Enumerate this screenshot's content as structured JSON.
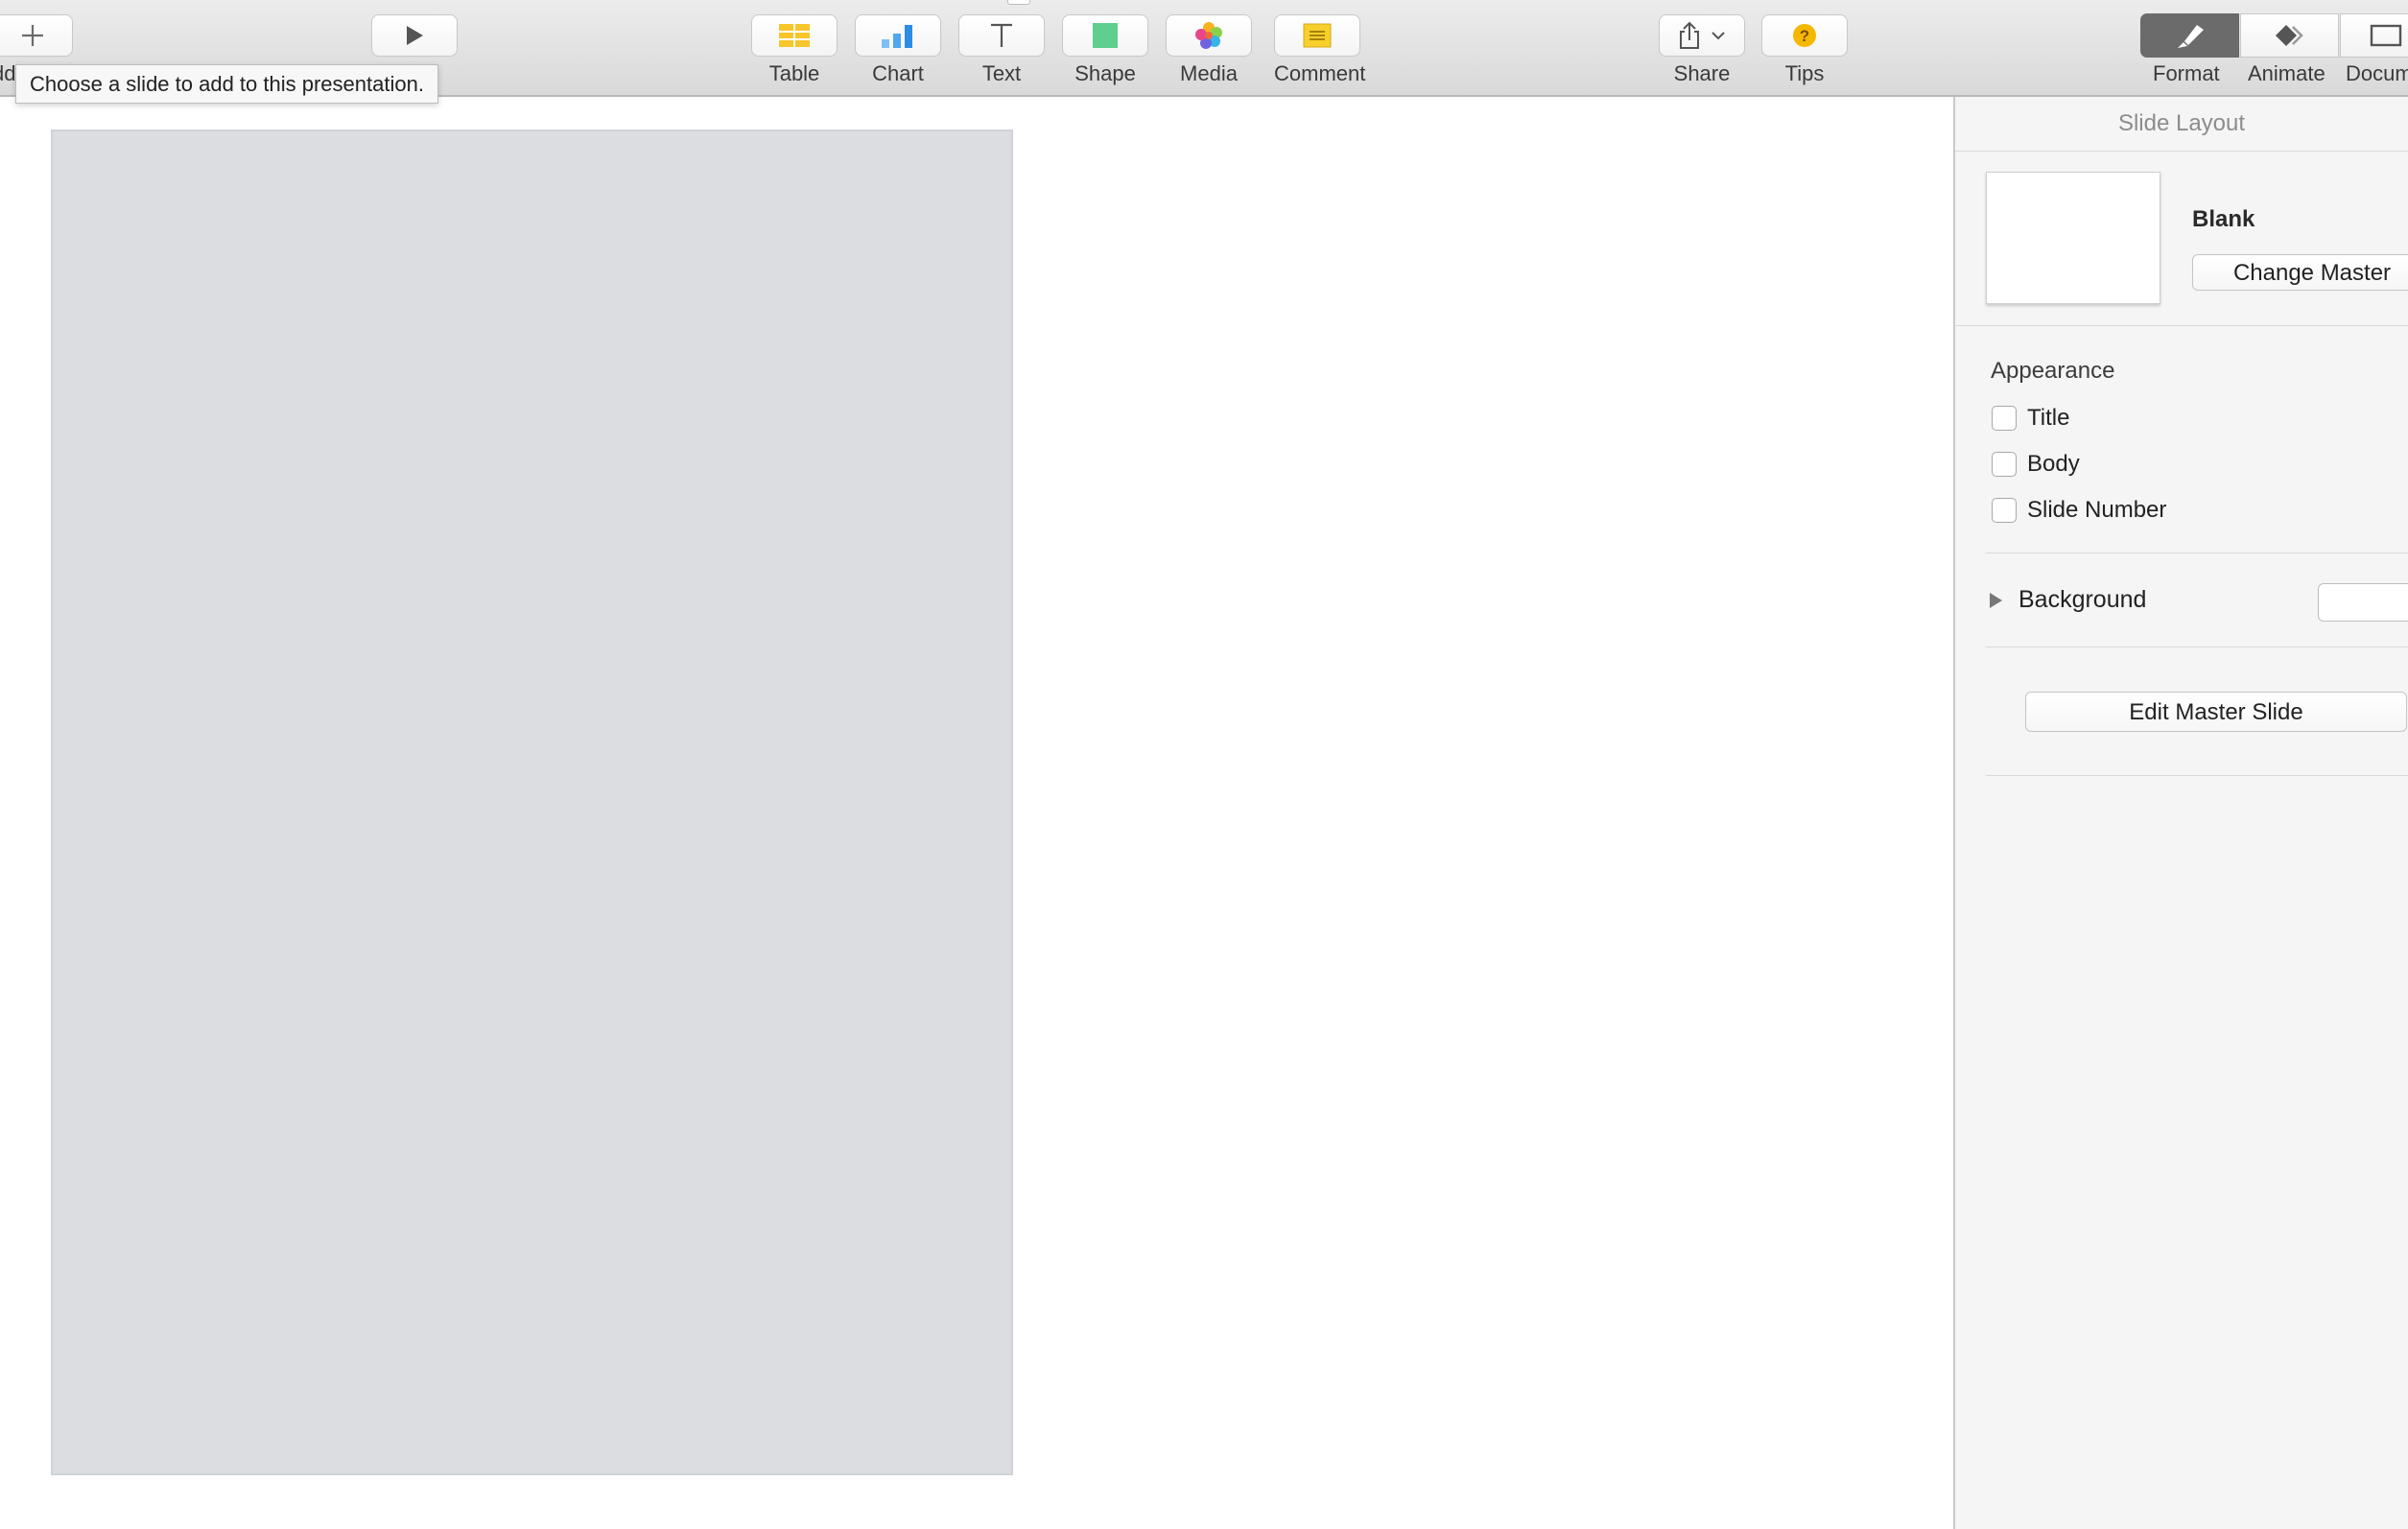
{
  "toolbar": {
    "add_slide_partial_label": "dd",
    "tools": [
      {
        "label": "Table",
        "icon": "table-icon"
      },
      {
        "label": "Chart",
        "icon": "chart-icon"
      },
      {
        "label": "Text",
        "icon": "text-icon"
      },
      {
        "label": "Shape",
        "icon": "shape-icon"
      },
      {
        "label": "Media",
        "icon": "media-icon"
      },
      {
        "label": "Comment",
        "icon": "comment-icon"
      }
    ],
    "share_label": "Share",
    "tips_label": "Tips",
    "format_label": "Format",
    "animate_label": "Animate",
    "document_label": "Docum"
  },
  "tooltip": {
    "text": "Choose a slide to add to this presentation."
  },
  "inspector": {
    "title": "Slide Layout",
    "layout_name": "Blank",
    "change_master_label": "Change Master",
    "appearance_heading": "Appearance",
    "checkboxes": [
      {
        "label": "Title",
        "checked": false
      },
      {
        "label": "Body",
        "checked": false
      },
      {
        "label": "Slide Number",
        "checked": false
      }
    ],
    "background_label": "Background",
    "edit_master_label": "Edit Master Slide"
  },
  "colors": {
    "toolbar_bg": "#dcdcdc",
    "slide_fill": "#dcdde0",
    "inspector_bg": "#f5f5f5",
    "format_selected": "#6b6b6b",
    "table_yellow": "#f8c52b",
    "chart_blue": "#2e8ce6",
    "shape_green": "#5ecf8e",
    "tips_yellow": "#f5b800"
  }
}
